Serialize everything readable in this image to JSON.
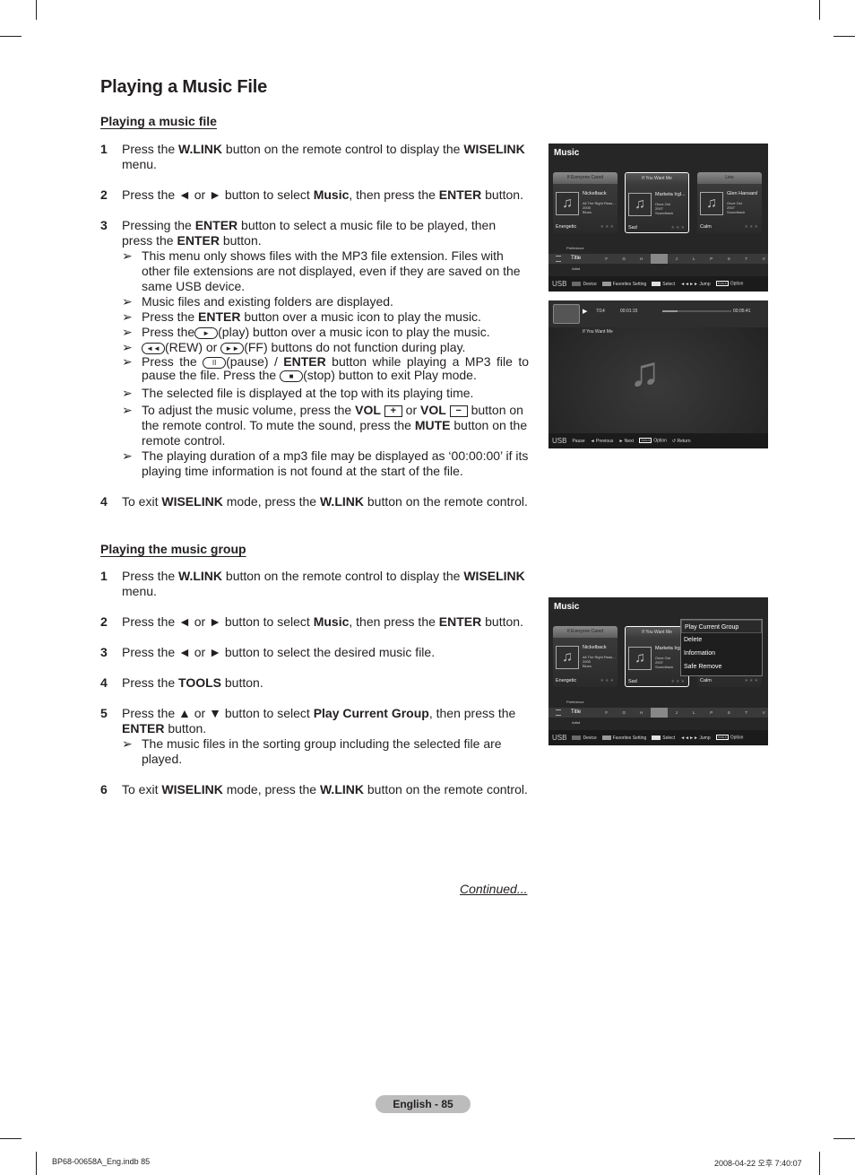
{
  "page_title": "Playing a Music File",
  "section1": {
    "title": "Playing a music file",
    "step1": {
      "num": "1",
      "a": "Press the ",
      "b1": "W.LINK",
      "c": " button on the remote control to display the ",
      "b2": "WISELINK",
      "d": " menu."
    },
    "step2": {
      "num": "2",
      "a": "Press the ◄ or ► button to select ",
      "b1": "Music",
      "c": ", then press the ",
      "b2": "ENTER",
      "d": " button."
    },
    "step3": {
      "num": "3",
      "a": "Pressing the ",
      "b1": "ENTER",
      "c": " button to select a music file to be played, then press the ",
      "b2": "ENTER",
      "d": " button."
    },
    "notes": {
      "arrow": "➢",
      "n1": "This menu only shows files with the MP3 file extension. Files with other file extensions are not displayed, even if they are saved on the same USB device.",
      "n2": "Music files and existing folders are displayed.",
      "n3a": "Press the ",
      "n3b": "ENTER",
      "n3c": " button over a music icon to play the music.",
      "n4a": "Press the",
      "n4btn": "►",
      "n4c": "(play) button over a music icon to play the music.",
      "n5btn1": "◄◄",
      "n5a": "(REW) or ",
      "n5btn2": "►►",
      "n5b": "(FF) buttons do not function during play.",
      "n6a": "Press the ",
      "n6btn1": "II",
      "n6b": "(pause) / ",
      "n6c": "ENTER",
      "n6d": " button while playing a MP3 file to pause the file. Press the ",
      "n6btn2": "■",
      "n6e": "(stop) button to exit Play mode.",
      "n7": "The selected file is displayed at the top with its playing time.",
      "n8a": "To adjust the music volume, press the ",
      "n8b": "VOL",
      "n8plus": "+",
      "n8c": " or ",
      "n8d": "VOL",
      "n8minus": "−",
      "n8e": " button on the remote control. To mute the sound, press the ",
      "n8f": "MUTE",
      "n8g": " button on the remote control.",
      "n9": "The playing duration of a mp3 file may be displayed as ‘00:00:00’ if its playing time information is not found at the start of the file."
    },
    "step4": {
      "num": "4",
      "a": "To exit ",
      "b1": "WISELINK",
      "c": " mode, press the ",
      "b2": "W.LINK",
      "d": " button on the remote control."
    }
  },
  "section2": {
    "title": "Playing the music group",
    "step1": {
      "num": "1",
      "a": "Press the ",
      "b1": "W.LINK",
      "c": " button on the remote control to display the ",
      "b2": "WISELINK",
      "d": " menu."
    },
    "step2": {
      "num": "2",
      "a": "Press the ◄ or ► button to select ",
      "b1": "Music",
      "c": ", then press the ",
      "b2": "ENTER",
      "d": " button."
    },
    "step3": {
      "num": "3",
      "a": "Press the ◄ or ► button to select the desired music file."
    },
    "step4": {
      "num": "4",
      "a": "Press the ",
      "b1": "TOOLS",
      "c": " button."
    },
    "step5": {
      "num": "5",
      "a": "Press the ▲ or ▼ button to select ",
      "b1": "Play Current Group",
      "c": ", then press the ",
      "b2": "ENTER",
      "d": " button."
    },
    "step5_note": "The music files in the sorting group including the selected file are played.",
    "step6": {
      "num": "6",
      "a": "To exit ",
      "b1": "WISELINK",
      "c": " mode, press the ",
      "b2": "W.LINK",
      "d": " button on the remote control."
    }
  },
  "continued": "Continued...",
  "page_badge": "English - 85",
  "footer": {
    "left": "BP68-00658A_Eng.indb   85",
    "right": "2008-04-22   오후 7:40:07"
  },
  "tv_music": {
    "title": "Music",
    "cards": [
      {
        "title": "If Everyone Cared",
        "artist": "Nickelback",
        "meta": [
          "All The Right Reas...",
          "2005",
          "Blues"
        ],
        "mood": "Energetic",
        "stars": "★★★"
      },
      {
        "title": "If You Want Me",
        "artist": "Marketa Irgl...",
        "meta": [
          "Once Ost",
          "2007",
          "Soundtrack"
        ],
        "mood": "Sad",
        "stars": "★★★"
      },
      {
        "title": "Lies",
        "artist": "Glen Hansard",
        "meta": [
          "Once Ost",
          "2007",
          "Soundtrack"
        ],
        "mood": "Calm",
        "stars": "★★★"
      }
    ],
    "sort_prev": "Preference",
    "sort_current": "Title",
    "sort_next": "Artist",
    "letters": [
      "F",
      "G",
      "H",
      "I",
      "J",
      "L",
      "P",
      "S",
      "T",
      "V"
    ],
    "bottom": {
      "usb": "USB",
      "device": "Device",
      "favorites": "Favorites Setting",
      "select": "Select",
      "jump": "◄◄►► Jump",
      "tools": "TOOLS",
      "option": "Option"
    },
    "key_colors": {
      "device": "#6b6b6b",
      "favorites": "#9a9a9a",
      "select": "#e0e0e0"
    }
  },
  "tv_player": {
    "track_pos": "7/14",
    "elapsed": "00:01:15",
    "total": "00:05:41",
    "progress_fraction": 0.22,
    "song": "If You Want Me",
    "bottom": {
      "usb": "USB",
      "pause": "Pause",
      "previous": "◄ Previous",
      "next": "► Next",
      "tools": "TOOLS",
      "option": "Option",
      "return": "↺ Return"
    }
  },
  "tv_group": {
    "title": "Music",
    "cards": [
      {
        "title": "If Everyone Cared",
        "artist": "Nickelback",
        "meta": [
          "All The Right Reas...",
          "2005",
          "Blues"
        ],
        "mood": "Energetic",
        "stars": "★★★"
      },
      {
        "title": "If You Want Me",
        "artist": "Marketa Irg",
        "meta": [
          "Once Ost",
          "2007",
          "Soundtrack"
        ],
        "mood": "Sad",
        "stars": "★★★"
      },
      {
        "title": "",
        "artist": "",
        "meta": [
          "",
          "",
          ""
        ],
        "mood": "Calm",
        "stars": "★★★"
      }
    ],
    "popup": [
      "Play Current Group",
      "Delete",
      "Information",
      "Safe Remove"
    ]
  }
}
